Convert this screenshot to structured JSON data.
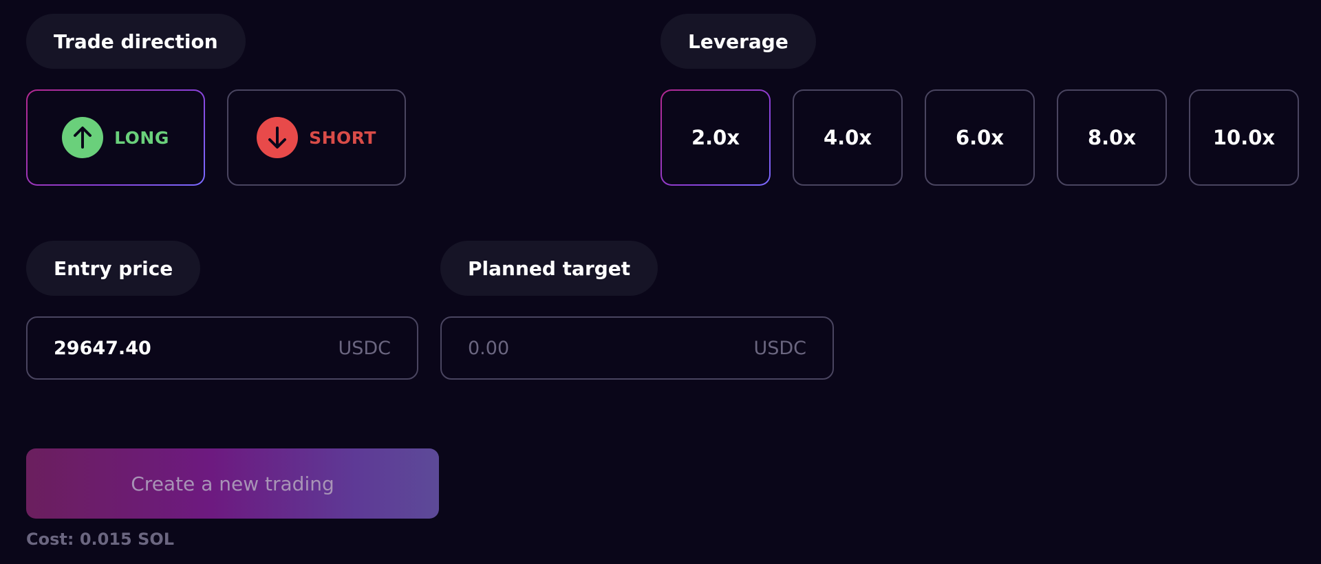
{
  "trade_direction": {
    "label": "Trade direction",
    "options": [
      {
        "label": "LONG",
        "icon": "arrow-up-icon",
        "color": "#6ad07b",
        "selected": true
      },
      {
        "label": "SHORT",
        "icon": "arrow-down-icon",
        "color": "#e84a4a",
        "selected": false
      }
    ]
  },
  "leverage": {
    "label": "Leverage",
    "options": [
      "2.0x",
      "4.0x",
      "6.0x",
      "8.0x",
      "10.0x"
    ],
    "selected": "2.0x"
  },
  "entry_price": {
    "label": "Entry price",
    "value": "29647.40",
    "unit": "USDC"
  },
  "planned_target": {
    "label": "Planned target",
    "placeholder": "0.00",
    "value": "",
    "unit": "USDC"
  },
  "create_button": {
    "label": "Create a new trading"
  },
  "cost": {
    "text": "Cost: 0.015 SOL"
  },
  "colors": {
    "background": "#0a0619",
    "accent_gradient_start": "#b3288f",
    "accent_gradient_end": "#7a6bff",
    "long": "#6ad07b",
    "short": "#e84a4a"
  }
}
